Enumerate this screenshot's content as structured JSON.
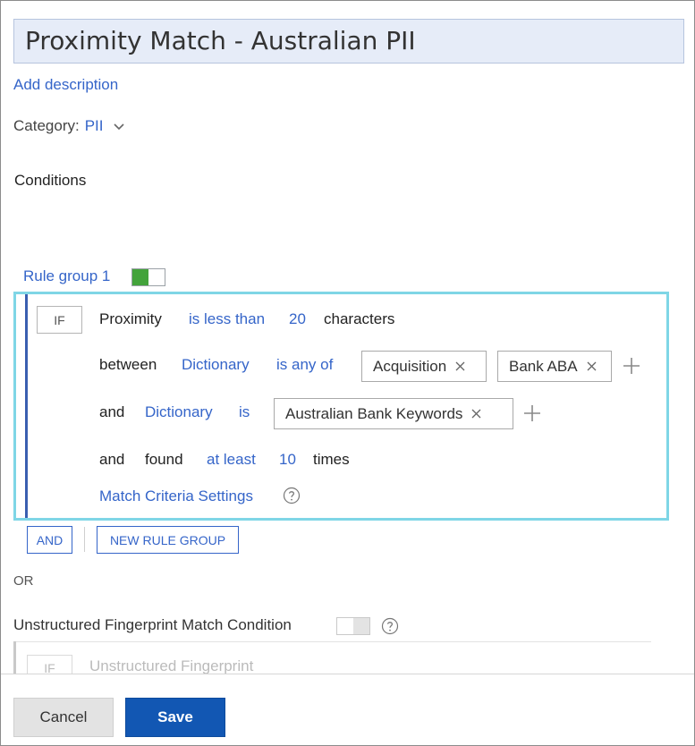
{
  "policy": {
    "title": "Proximity Match - Australian PII",
    "add_description": "Add description",
    "category_label": "Category:",
    "category_value": "PII"
  },
  "conditions": {
    "heading": "Conditions",
    "rule_group": {
      "label": "Rule group 1",
      "enabled": true,
      "if_label": "IF",
      "row1": {
        "subject": "Proximity",
        "operator": "is less than",
        "value": "20",
        "unit": "characters"
      },
      "row2": {
        "connector": "between",
        "source": "Dictionary",
        "operator": "is any of",
        "chips": [
          "Acquisition",
          "Bank ABA"
        ]
      },
      "row3": {
        "connector": "and",
        "source": "Dictionary",
        "operator": "is",
        "chips": [
          "Australian Bank Keywords"
        ]
      },
      "row4": {
        "connector": "and",
        "verb": "found",
        "operator": "at least",
        "value": "10",
        "unit": "times"
      },
      "match_criteria": "Match Criteria Settings"
    },
    "and_button": "AND",
    "new_rule_group_button": "NEW RULE GROUP",
    "or_label": "OR",
    "ufp": {
      "label": "Unstructured Fingerprint Match Condition",
      "enabled": false,
      "if_label": "IF",
      "text": "Unstructured Fingerprint"
    }
  },
  "footer": {
    "cancel": "Cancel",
    "save": "Save"
  },
  "colors": {
    "accent": "#3565c9",
    "primary_button": "#1257b3",
    "toggle_on": "#43a33b",
    "rule_box_border": "#7fd6e6"
  }
}
